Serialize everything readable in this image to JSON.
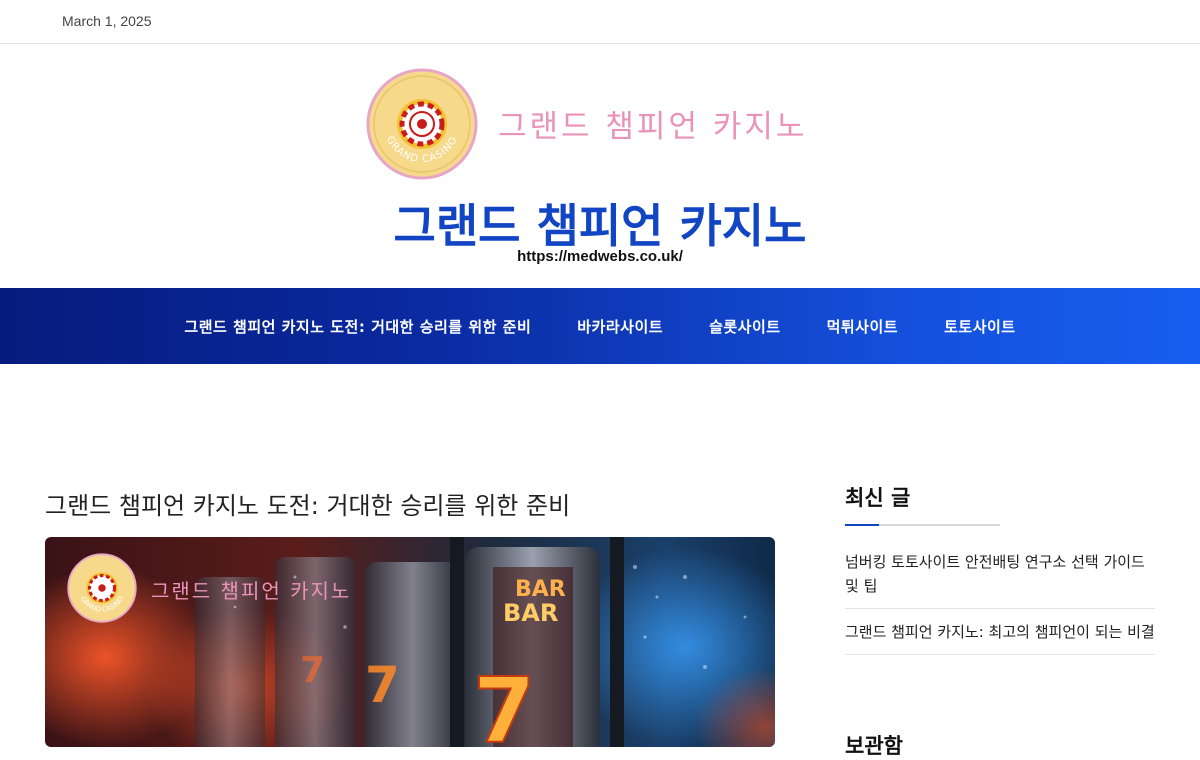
{
  "topbar": {
    "date": "March 1, 2025"
  },
  "brand": {
    "logo_ring_text": "GRAND CASINO",
    "script_name": "그랜드 챔피언 카지노",
    "title": "그랜드 챔피언 카지노",
    "tagline": "https://medwebs.co.uk/"
  },
  "nav": {
    "items": [
      "그랜드 챔피언 카지노 도전: 거대한 승리를 위한 준비",
      "바카라사이트",
      "슬롯사이트",
      "먹튀사이트",
      "토토사이트"
    ]
  },
  "post": {
    "title": "그랜드 챔피언 카지노 도전: 거대한 승리를 위한 준비",
    "hero_script": "그랜드 챔피언 카지노",
    "hero_ring_text": "GRAND CASINO",
    "reel_label_1": "BAR",
    "reel_label_2": "BAR",
    "reel_digit": "7"
  },
  "sidebar": {
    "heading": "최신 글",
    "items": [
      "넘버킹 토토사이트 안전배팅 연구소 선택 가이드 및 팁",
      "그랜드 챔피언 카지노: 최고의 챔피언이 되는 비결"
    ],
    "next_heading": "보관함"
  },
  "colors": {
    "accent": "#1245c4",
    "nav_start": "#061b7d",
    "nav_end": "#175ef0",
    "script_pink": "#ea93b8",
    "logo_gold": "#f6d98a"
  }
}
